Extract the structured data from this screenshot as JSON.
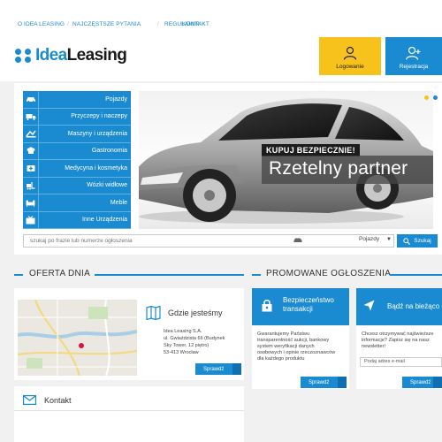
{
  "topnav": {
    "links": [
      "O IDEA LEASING",
      "NAJCZĘSTSZE PYTANIA",
      "REGULAMIN",
      "KONTAKT"
    ]
  },
  "logo": {
    "part1": "Idea",
    "part2": "Leasing"
  },
  "header": {
    "login_label": "Logowanie",
    "register_label": "Rejestracja"
  },
  "categories": [
    {
      "label": "Pojazdy",
      "icon": "car-icon"
    },
    {
      "label": "Przyczepy i naczepy",
      "icon": "truck-icon"
    },
    {
      "label": "Maszyny i urządzenia",
      "icon": "machine-icon"
    },
    {
      "label": "Gastronomia",
      "icon": "chef-icon"
    },
    {
      "label": "Medycyna i kosmetyka",
      "icon": "medical-icon"
    },
    {
      "label": "Wózki widłowe",
      "icon": "forklift-icon"
    },
    {
      "label": "Meble",
      "icon": "furniture-icon"
    },
    {
      "label": "Inne Urządzenia",
      "icon": "tv-icon"
    }
  ],
  "hero": {
    "tag": "KUPUJ BEZPIECZNIE!",
    "headline": "Rzetelny partner"
  },
  "search": {
    "placeholder": "szukaj po frazie lub numerze ogłoszenia",
    "category": "Pojazdy",
    "button": "Szukaj"
  },
  "sections": {
    "offer": "OFERTA DNIA",
    "promoted": "PROMOWANE OGŁOSZENIA"
  },
  "location": {
    "title": "Gdzie jesteśmy",
    "address": [
      "Idea Leasing S.A.",
      "ul. Gwiaździsta 66 (Budynek",
      "Sky Tower, 12 piętro)",
      "53-413 Wrocław"
    ],
    "button": "Sprawdź"
  },
  "contact": {
    "title": "Kontakt"
  },
  "promo_security": {
    "title_lines": [
      "Bezpieczeństwo",
      "transakcji"
    ],
    "text": [
      "Gwarantujemy Państwu",
      "transparentność aukcji, bankowy",
      "system weryfikacji danych",
      "osobowych i opinie rzeczoznawców",
      "dla każdego produktu"
    ],
    "button": "Sprawdź"
  },
  "promo_newsletter": {
    "title": "Bądź na bieżąco",
    "text": [
      "Chcesz otrzymywać najświeższe",
      "informacje? Zapisz się na nasz",
      "newsletter!"
    ],
    "email_placeholder": "Podaj adres e-mail",
    "button": "Sprawdź"
  },
  "colors": {
    "accent": "#1a8bd1",
    "login": "#f7c21b",
    "dot_active": "#f7c21b"
  }
}
